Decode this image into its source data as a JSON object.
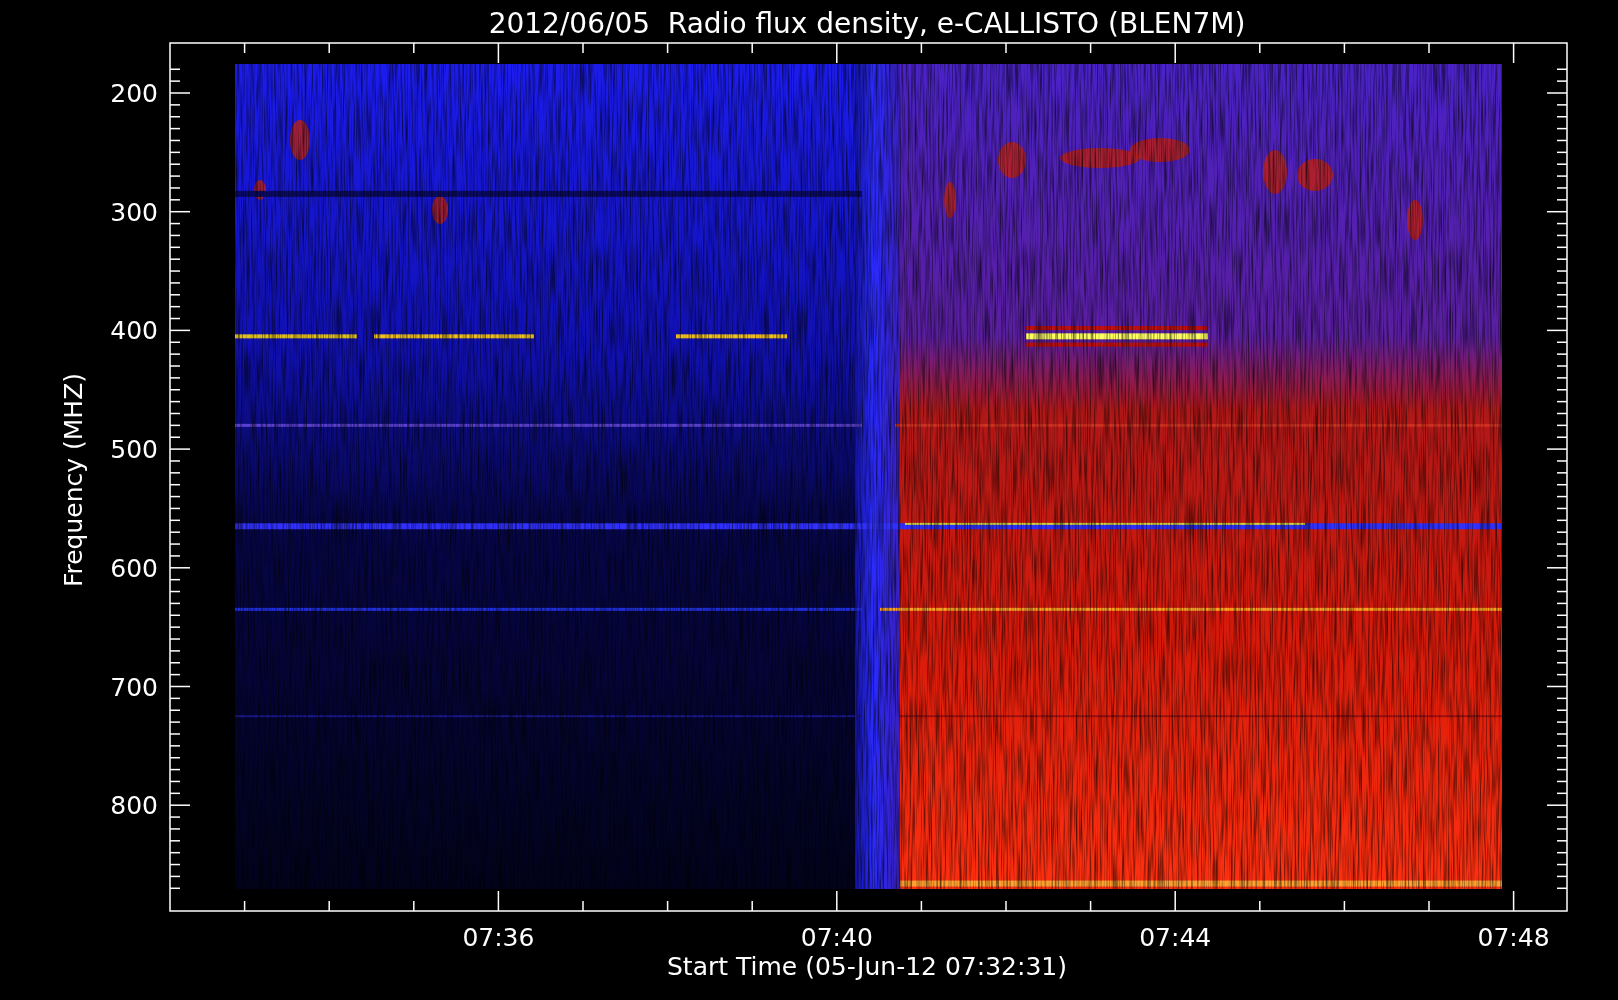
{
  "title": "2012/06/05  Radio flux density, e-CALLISTO (BLEN7M)",
  "y_axis": {
    "label": "Frequency (MHZ)",
    "ticks": [
      "200",
      "300",
      "400",
      "500",
      "600",
      "700",
      "800"
    ]
  },
  "x_axis": {
    "label": "Start Time (05-Jun-12 07:32:31)",
    "ticks": [
      "07:36",
      "07:40",
      "07:44",
      "07:48"
    ]
  }
}
